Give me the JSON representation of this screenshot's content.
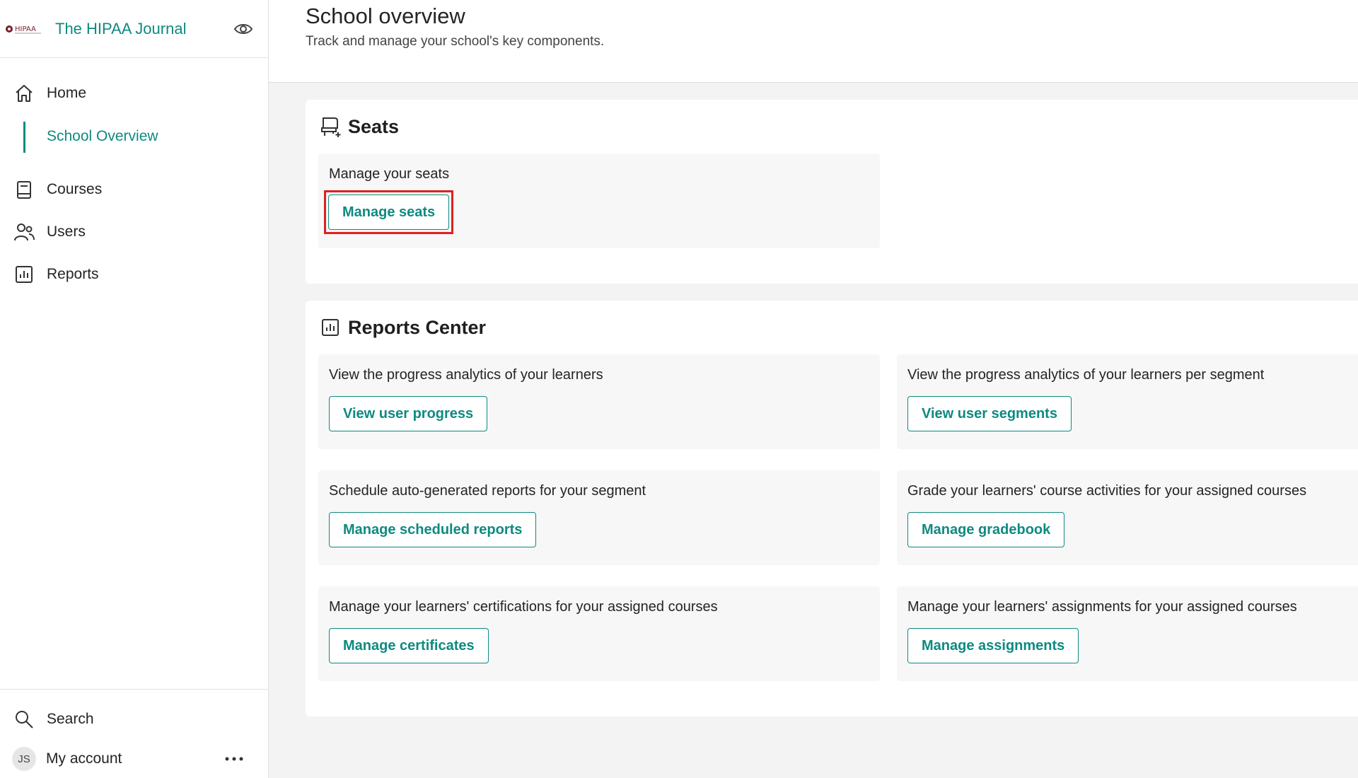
{
  "brand": {
    "name": "The HIPAA Journal",
    "logo_text": "HIPAA"
  },
  "sidebar": {
    "items": [
      {
        "label": "Home",
        "icon": "home-icon"
      },
      {
        "label": "School Overview",
        "active": true
      },
      {
        "label": "Courses",
        "icon": "book-icon"
      },
      {
        "label": "Users",
        "icon": "users-icon"
      },
      {
        "label": "Reports",
        "icon": "chart-icon"
      }
    ],
    "bottom": {
      "search_label": "Search",
      "account_label": "My account",
      "avatar_initials": "JS"
    }
  },
  "page": {
    "title": "School overview",
    "subtitle": "Track and manage your school's key components."
  },
  "seats": {
    "title": "Seats",
    "tile": {
      "description": "Manage your seats",
      "button": "Manage seats"
    }
  },
  "reports_center": {
    "title": "Reports Center",
    "tiles": [
      {
        "description": "View the progress analytics of your learners",
        "button": "View user progress"
      },
      {
        "description": "View the progress analytics of your learners per segment",
        "button": "View user segments"
      },
      {
        "description": "Schedule auto-generated reports for your segment",
        "button": "Manage scheduled reports"
      },
      {
        "description": "Grade your learners' course activities for your assigned courses",
        "button": "Manage gradebook"
      },
      {
        "description": "Manage your learners' certifications for your assigned courses",
        "button": "Manage certificates"
      },
      {
        "description": "Manage your learners' assignments for your assigned courses",
        "button": "Manage assignments"
      }
    ]
  },
  "colors": {
    "accent": "#0e8a80",
    "highlight": "#e02020",
    "background": "#f3f3f3"
  }
}
